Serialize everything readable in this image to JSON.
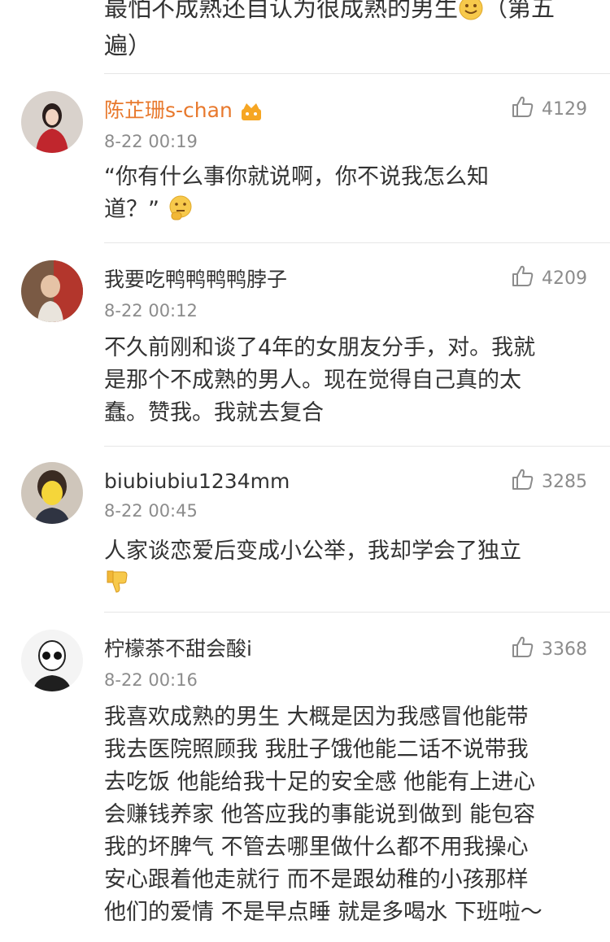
{
  "top_fragment": {
    "line1": "最怕不成熟还自认为很成熟的男生",
    "line1_tail": "（第五",
    "line2": "遍）",
    "emoji": "smile-emoji"
  },
  "comments": [
    {
      "username": "陈芷珊s-chan",
      "badge": "vip-crown-icon",
      "time": "8-22 00:19",
      "likes": "4129",
      "text_lines": [
        "“你有什么事你就说啊，你不说我怎么知",
        "道？”"
      ],
      "trailing_emoji": "thinking-emoji"
    },
    {
      "username": "我要吃鸭鸭鸭鸭脖子",
      "time": "8-22 00:12",
      "likes": "4209",
      "text_lines": [
        "不久前刚和谈了4年的女朋友分手，对。我就",
        "是那个不成熟的男人。现在觉得自己真的太",
        "蠢。赞我。我就去复合"
      ]
    },
    {
      "username": "biubiubiu1234mm",
      "time": "8-22 00:45",
      "likes": "3285",
      "text_lines": [
        "人家谈恋爱后变成小公举，我却学会了独立"
      ],
      "trailing_emoji": "thumbs-down-emoji"
    },
    {
      "username": "柠檬茶不甜会酸i",
      "time": "8-22 00:16",
      "likes": "3368",
      "text_lines": [
        "我喜欢成熟的男生 大概是因为我感冒他能带",
        "我去医院照顾我 我肚子饿他能二话不说带我",
        "去吃饭 他能给我十足的安全感 他能有上进心",
        "会赚钱养家 他答应我的事能说到做到 能包容",
        "我的坏脾气 不管去哪里做什么都不用我操心",
        "安心跟着他走就行 而不是跟幼稚的小孩那样",
        "他们的爱情 不是早点睡 就是多喝水 下班啦～"
      ]
    }
  ],
  "colors": {
    "vip_username": "#e8792d",
    "meta_gray": "#8c8c8c",
    "text": "#333333",
    "divider": "#e6e6e6"
  }
}
